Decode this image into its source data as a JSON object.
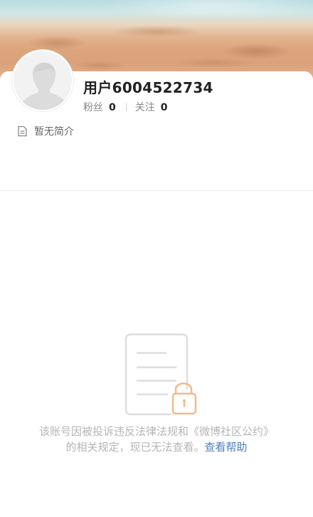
{
  "profile": {
    "username": "用户6004522734",
    "followers_label": "粉丝",
    "followers_count": "0",
    "following_label": "关注",
    "following_count": "0",
    "bio": "暂无简介"
  },
  "notice": {
    "message": "该账号因被投诉违反法律法规和《微博社区公约》的相关规定，现已无法查看。",
    "help_link": "查看帮助"
  },
  "icons": {
    "avatar": "default-avatar-icon",
    "bio": "document-icon",
    "locked": "locked-document-icon"
  },
  "colors": {
    "link": "#4a7fc1",
    "lock": "#f5b989",
    "muted": "#b5b5b5"
  }
}
